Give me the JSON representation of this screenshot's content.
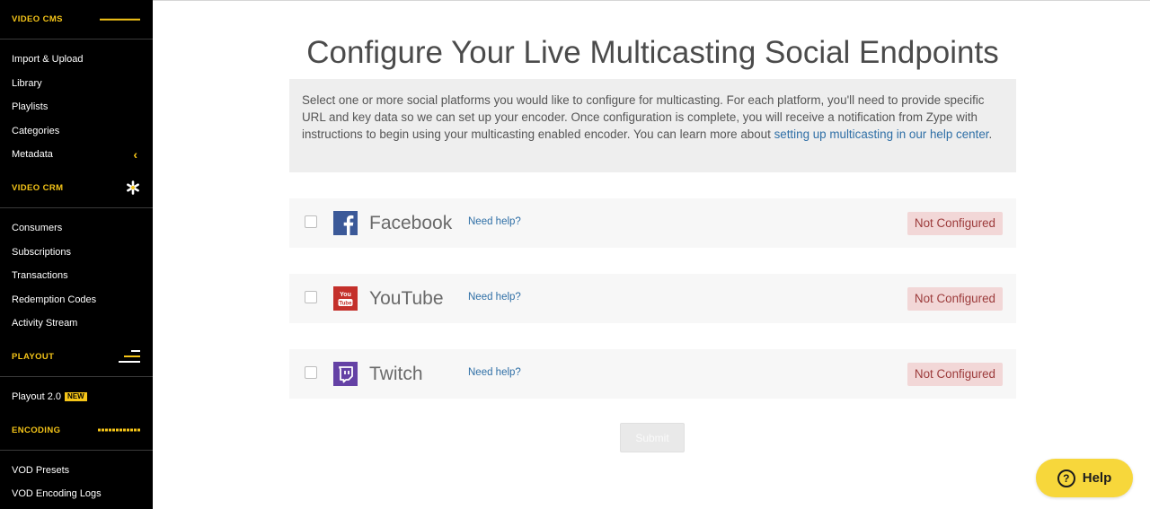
{
  "sidebar": {
    "sections": [
      {
        "title": "VIDEO CMS",
        "icon": "hamburger-menu-icon",
        "items": [
          {
            "label": "Import & Upload"
          },
          {
            "label": "Library"
          },
          {
            "label": "Playlists"
          },
          {
            "label": "Categories"
          },
          {
            "label": "Metadata",
            "expand_icon": "chevron-left-icon"
          }
        ]
      },
      {
        "title": "VIDEO CRM",
        "icon": "asterisk-icon",
        "items": [
          {
            "label": "Consumers"
          },
          {
            "label": "Subscriptions"
          },
          {
            "label": "Transactions"
          },
          {
            "label": "Redemption Codes"
          },
          {
            "label": "Activity Stream"
          }
        ]
      },
      {
        "title": "PLAYOUT",
        "icon": "playout-lines-icon",
        "items": [
          {
            "label": "Playout 2.0",
            "badge": "NEW"
          }
        ]
      },
      {
        "title": "ENCODING",
        "icon": "grid-icon",
        "items": [
          {
            "label": "VOD Presets"
          },
          {
            "label": "VOD Encoding Logs"
          }
        ]
      }
    ]
  },
  "main": {
    "title": "Configure Your Live Multicasting Social Endpoints",
    "intro_text": "Select one or more social platforms you would like to configure for multicasting. For each platform, you'll need to provide specific URL and key data so we can set up your encoder. Once configuration is complete, you will receive a notification from Zype with instructions to begin using your multicasting enabled encoder. You can learn more about ",
    "intro_link": "setting up multicasting in our help center",
    "intro_end": ".",
    "platforms": [
      {
        "name": "Facebook",
        "help": "Need help?",
        "status": "Not Configured",
        "icon": "facebook-icon",
        "color": "#3b5998"
      },
      {
        "name": "YouTube",
        "help": "Need help?",
        "status": "Not Configured",
        "icon": "youtube-icon",
        "color": "#c4302b"
      },
      {
        "name": "Twitch",
        "help": "Need help?",
        "status": "Not Configured",
        "icon": "twitch-icon",
        "color": "#6441a5"
      }
    ],
    "submit_label": "Submit"
  },
  "help_widget": {
    "label": "Help",
    "icon": "question-circle-icon"
  },
  "colors": {
    "accent": "#f5c518",
    "sidebar_bg": "#000000",
    "status_bg": "#f2d7d7",
    "status_text": "#9c3b3b",
    "link": "#2f6fa6"
  }
}
